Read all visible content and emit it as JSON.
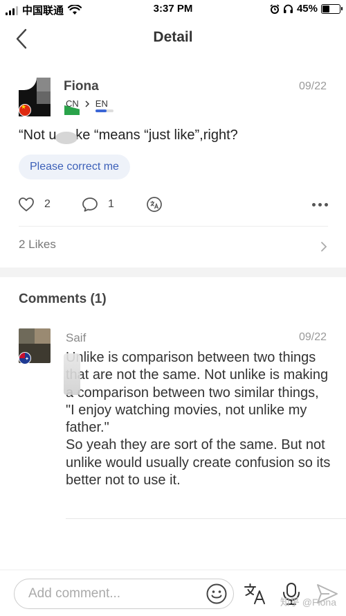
{
  "status_bar": {
    "carrier": "中国联通",
    "time": "3:37 PM",
    "battery": "45%",
    "battery_level": 0.45
  },
  "nav": {
    "title": "Detail"
  },
  "post": {
    "author": "Fiona",
    "date": "09/22",
    "lang_from": "CN",
    "lang_to": "EN",
    "text": "“Not u     ke “means “just like”,right?",
    "chip_label": "Please correct me",
    "likes_count": "2",
    "comments_count": "1",
    "likes_summary": "2 Likes"
  },
  "comments": {
    "title": "Comments (1)",
    "items": [
      {
        "author": "Saif",
        "date": "09/22",
        "paragraphs": [
          "Unlike is comparison between two things that are not the same. Not unlike is making a comparison between two similar things,",
          "\"I enjoy watching movies, not unlike my father.\"",
          "So yeah they are sort of the same. But not unlike would usually create confusion so its better not to use it."
        ]
      }
    ]
  },
  "bottom_bar": {
    "placeholder": "Add comment...",
    "watermark": "知乎 @Fiona"
  },
  "colors": {
    "accent": "#3b5fb8",
    "chip_bg": "#eef2f9"
  }
}
